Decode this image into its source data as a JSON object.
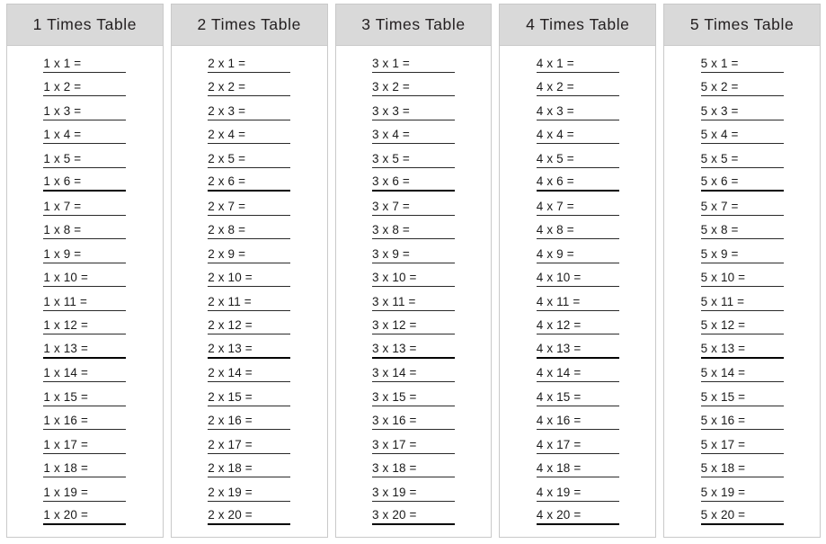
{
  "page": {
    "title": "Times Tables Practice Worksheet",
    "background_color": "#ffffff",
    "header_background_color": "#d9d9d9",
    "border_color": "#c9c9c9",
    "text_color": "#1a1a1a",
    "rule_color": "#2a2a2a",
    "emphasis_rule_color": "#000000"
  },
  "layout": {
    "columns": 5,
    "rows_per_column": 20,
    "multiplier_start": 1,
    "multiplier_end": 20,
    "emphasis_rows": [
      6,
      13,
      20
    ],
    "operator_symbol": "x",
    "equals_symbol": "="
  },
  "tables": [
    {
      "header": "1 Times  Table",
      "base": 1,
      "rows": [
        {
          "text": "1 x 1 =",
          "answer": "",
          "emphasis": false
        },
        {
          "text": "1 x 2 =",
          "answer": "",
          "emphasis": false
        },
        {
          "text": "1 x 3 =",
          "answer": "",
          "emphasis": false
        },
        {
          "text": "1 x 4 =",
          "answer": "",
          "emphasis": false
        },
        {
          "text": "1 x 5 =",
          "answer": "",
          "emphasis": false
        },
        {
          "text": "1 x 6 =",
          "answer": "",
          "emphasis": true
        },
        {
          "text": "1 x 7 =",
          "answer": "",
          "emphasis": false
        },
        {
          "text": "1 x 8 =",
          "answer": "",
          "emphasis": false
        },
        {
          "text": "1 x 9 =",
          "answer": "",
          "emphasis": false
        },
        {
          "text": "1 x 10 =",
          "answer": "",
          "emphasis": false
        },
        {
          "text": "1 x 11 =",
          "answer": "",
          "emphasis": false
        },
        {
          "text": "1 x 12 =",
          "answer": "",
          "emphasis": false
        },
        {
          "text": "1 x 13 =",
          "answer": "",
          "emphasis": true
        },
        {
          "text": "1 x 14 =",
          "answer": "",
          "emphasis": false
        },
        {
          "text": "1 x 15 =",
          "answer": "",
          "emphasis": false
        },
        {
          "text": "1 x 16 =",
          "answer": "",
          "emphasis": false
        },
        {
          "text": "1 x 17 =",
          "answer": "",
          "emphasis": false
        },
        {
          "text": "1 x 18 =",
          "answer": "",
          "emphasis": false
        },
        {
          "text": "1 x 19 =",
          "answer": "",
          "emphasis": false
        },
        {
          "text": "1 x 20 =",
          "answer": "",
          "emphasis": true
        }
      ]
    },
    {
      "header": "2 Times  Table",
      "base": 2,
      "rows": [
        {
          "text": "2 x 1 =",
          "answer": "",
          "emphasis": false
        },
        {
          "text": "2 x 2 =",
          "answer": "",
          "emphasis": false
        },
        {
          "text": "2 x 3 =",
          "answer": "",
          "emphasis": false
        },
        {
          "text": "2 x 4 =",
          "answer": "",
          "emphasis": false
        },
        {
          "text": "2 x 5 =",
          "answer": "",
          "emphasis": false
        },
        {
          "text": "2 x 6 =",
          "answer": "",
          "emphasis": true
        },
        {
          "text": "2 x 7 =",
          "answer": "",
          "emphasis": false
        },
        {
          "text": "2 x 8 =",
          "answer": "",
          "emphasis": false
        },
        {
          "text": "2 x 9 =",
          "answer": "",
          "emphasis": false
        },
        {
          "text": "2 x 10 =",
          "answer": "",
          "emphasis": false
        },
        {
          "text": "2 x 11 =",
          "answer": "",
          "emphasis": false
        },
        {
          "text": "2 x 12 =",
          "answer": "",
          "emphasis": false
        },
        {
          "text": "2 x 13 =",
          "answer": "",
          "emphasis": true
        },
        {
          "text": "2 x 14 =",
          "answer": "",
          "emphasis": false
        },
        {
          "text": "2 x 15 =",
          "answer": "",
          "emphasis": false
        },
        {
          "text": "2 x 16 =",
          "answer": "",
          "emphasis": false
        },
        {
          "text": "2 x 17 =",
          "answer": "",
          "emphasis": false
        },
        {
          "text": "2 x 18 =",
          "answer": "",
          "emphasis": false
        },
        {
          "text": "2 x 19 =",
          "answer": "",
          "emphasis": false
        },
        {
          "text": "2 x 20 =",
          "answer": "",
          "emphasis": true
        }
      ]
    },
    {
      "header": "3 Times  Table",
      "base": 3,
      "rows": [
        {
          "text": "3 x 1 =",
          "answer": "",
          "emphasis": false
        },
        {
          "text": "3 x 2 =",
          "answer": "",
          "emphasis": false
        },
        {
          "text": "3 x 3 =",
          "answer": "",
          "emphasis": false
        },
        {
          "text": "3 x 4 =",
          "answer": "",
          "emphasis": false
        },
        {
          "text": "3 x 5 =",
          "answer": "",
          "emphasis": false
        },
        {
          "text": "3 x 6 =",
          "answer": "",
          "emphasis": true
        },
        {
          "text": "3 x 7 =",
          "answer": "",
          "emphasis": false
        },
        {
          "text": "3 x 8 =",
          "answer": "",
          "emphasis": false
        },
        {
          "text": "3 x 9 =",
          "answer": "",
          "emphasis": false
        },
        {
          "text": "3 x 10 =",
          "answer": "",
          "emphasis": false
        },
        {
          "text": "3 x 11 =",
          "answer": "",
          "emphasis": false
        },
        {
          "text": "3 x 12 =",
          "answer": "",
          "emphasis": false
        },
        {
          "text": "3 x 13 =",
          "answer": "",
          "emphasis": true
        },
        {
          "text": "3 x 14 =",
          "answer": "",
          "emphasis": false
        },
        {
          "text": "3 x 15 =",
          "answer": "",
          "emphasis": false
        },
        {
          "text": "3 x 16 =",
          "answer": "",
          "emphasis": false
        },
        {
          "text": "3 x 17 =",
          "answer": "",
          "emphasis": false
        },
        {
          "text": "3 x 18 =",
          "answer": "",
          "emphasis": false
        },
        {
          "text": "3 x 19 =",
          "answer": "",
          "emphasis": false
        },
        {
          "text": "3 x 20 =",
          "answer": "",
          "emphasis": true
        }
      ]
    },
    {
      "header": "4 Times  Table",
      "base": 4,
      "rows": [
        {
          "text": "4 x 1 =",
          "answer": "",
          "emphasis": false
        },
        {
          "text": "4 x 2 =",
          "answer": "",
          "emphasis": false
        },
        {
          "text": "4 x 3 =",
          "answer": "",
          "emphasis": false
        },
        {
          "text": "4 x 4 =",
          "answer": "",
          "emphasis": false
        },
        {
          "text": "4 x 5 =",
          "answer": "",
          "emphasis": false
        },
        {
          "text": "4 x 6 =",
          "answer": "",
          "emphasis": true
        },
        {
          "text": "4 x 7 =",
          "answer": "",
          "emphasis": false
        },
        {
          "text": "4 x 8 =",
          "answer": "",
          "emphasis": false
        },
        {
          "text": "4 x 9 =",
          "answer": "",
          "emphasis": false
        },
        {
          "text": "4 x 10 =",
          "answer": "",
          "emphasis": false
        },
        {
          "text": "4 x 11 =",
          "answer": "",
          "emphasis": false
        },
        {
          "text": "4 x 12 =",
          "answer": "",
          "emphasis": false
        },
        {
          "text": "4 x 13 =",
          "answer": "",
          "emphasis": true
        },
        {
          "text": "4 x 14 =",
          "answer": "",
          "emphasis": false
        },
        {
          "text": "4 x 15 =",
          "answer": "",
          "emphasis": false
        },
        {
          "text": "4 x 16 =",
          "answer": "",
          "emphasis": false
        },
        {
          "text": "4 x 17 =",
          "answer": "",
          "emphasis": false
        },
        {
          "text": "4 x 18 =",
          "answer": "",
          "emphasis": false
        },
        {
          "text": "4 x 19 =",
          "answer": "",
          "emphasis": false
        },
        {
          "text": "4 x 20 =",
          "answer": "",
          "emphasis": true
        }
      ]
    },
    {
      "header": "5 Times  Table",
      "base": 5,
      "rows": [
        {
          "text": "5 x 1 =",
          "answer": "",
          "emphasis": false
        },
        {
          "text": "5 x 2 =",
          "answer": "",
          "emphasis": false
        },
        {
          "text": "5 x 3 =",
          "answer": "",
          "emphasis": false
        },
        {
          "text": "5 x 4 =",
          "answer": "",
          "emphasis": false
        },
        {
          "text": "5 x 5 =",
          "answer": "",
          "emphasis": false
        },
        {
          "text": "5 x 6 =",
          "answer": "",
          "emphasis": true
        },
        {
          "text": "5 x 7 =",
          "answer": "",
          "emphasis": false
        },
        {
          "text": "5 x 8 =",
          "answer": "",
          "emphasis": false
        },
        {
          "text": "5 x 9 =",
          "answer": "",
          "emphasis": false
        },
        {
          "text": "5 x 10 =",
          "answer": "",
          "emphasis": false
        },
        {
          "text": "5 x 11 =",
          "answer": "",
          "emphasis": false
        },
        {
          "text": "5 x 12 =",
          "answer": "",
          "emphasis": false
        },
        {
          "text": "5 x 13 =",
          "answer": "",
          "emphasis": true
        },
        {
          "text": "5 x 14 =",
          "answer": "",
          "emphasis": false
        },
        {
          "text": "5 x 15 =",
          "answer": "",
          "emphasis": false
        },
        {
          "text": "5 x 16 =",
          "answer": "",
          "emphasis": false
        },
        {
          "text": "5 x 17 =",
          "answer": "",
          "emphasis": false
        },
        {
          "text": "5 x 18 =",
          "answer": "",
          "emphasis": false
        },
        {
          "text": "5 x 19 =",
          "answer": "",
          "emphasis": false
        },
        {
          "text": "5 x 20 =",
          "answer": "",
          "emphasis": true
        }
      ]
    }
  ]
}
